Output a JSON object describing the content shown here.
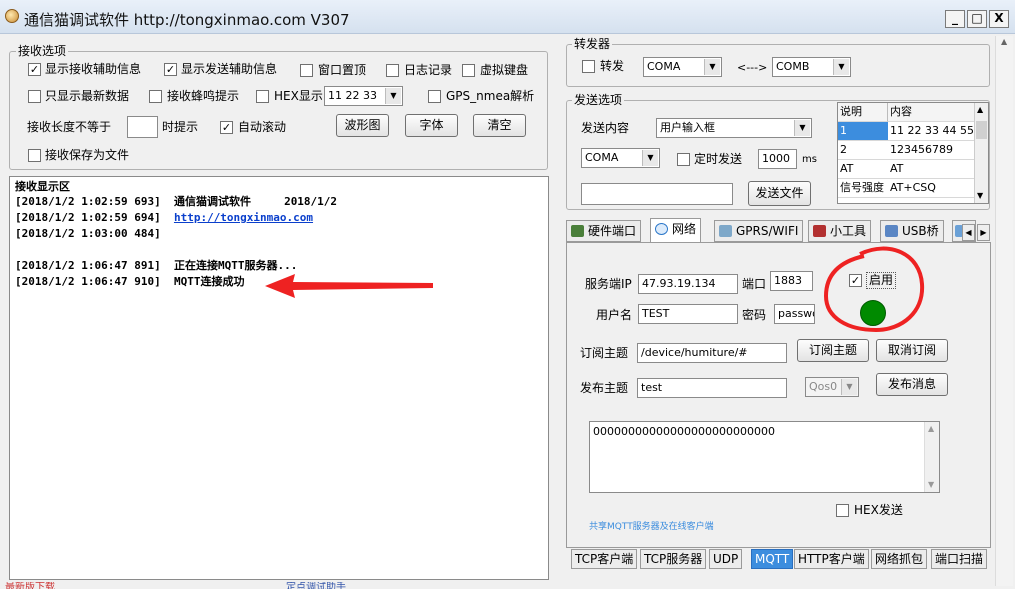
{
  "window": {
    "title": "通信猫调试软件  http://tongxinmao.com  V307",
    "minimize": "_",
    "maximize": "□",
    "close": "X"
  },
  "recv_options": {
    "group_label": "接收选项",
    "show_recv_info": "显示接收辅助信息",
    "show_send_info": "显示发送辅助信息",
    "window_top": "窗口置顶",
    "log_record": "日志记录",
    "virtual_keyboard": "虚拟键盘",
    "latest_only": "只显示最新数据",
    "beep": "接收蜂鸣提示",
    "hex_display": "HEX显示",
    "hex_value": "11 22 33",
    "gps": "GPS_nmea解析",
    "len_not_equal": "接收长度不等于",
    "len_value": "",
    "when_alert": "时提示",
    "auto_scroll": "自动滚动",
    "waveform_btn": "波形图",
    "font_btn": "字体",
    "clear_btn": "清空",
    "save_file": "接收保存为文件"
  },
  "recv_area": {
    "title": "接收显示区",
    "lines": [
      {
        "ts": "[2018/1/2 1:02:59 693]",
        "msg": "通信猫调试软件     2018/1/2"
      },
      {
        "ts": "[2018/1/2 1:02:59 694]",
        "link": "http://tongxinmao.com"
      },
      {
        "ts": "[2018/1/2 1:03:00 484]",
        "msg": ""
      },
      {
        "ts": "[2018/1/2 1:06:47 891]",
        "msg": "正在连接MQTT服务器..."
      },
      {
        "ts": "[2018/1/2 1:06:47 910]",
        "msg": "MQTT连接成功"
      }
    ]
  },
  "forwarder": {
    "group_label": "转发器",
    "forward_label": "转发",
    "port_a": "COMA",
    "arrow": "<--->",
    "port_b": "COMB"
  },
  "send_options": {
    "group_label": "发送选项",
    "content_label": "发送内容",
    "content_mode": "用户输入框",
    "port": "COMA",
    "timed_send": "定时发送",
    "interval": "1000",
    "unit": "ms",
    "input_value": "",
    "send_file_btn": "发送文件"
  },
  "cmd_table": {
    "headers": [
      "说明",
      "内容"
    ],
    "rows": [
      [
        "1",
        "11 22 33 44 55"
      ],
      [
        "2",
        "123456789"
      ],
      [
        "AT",
        "AT"
      ],
      [
        "信号强度",
        "AT+CSQ"
      ]
    ]
  },
  "top_tabs": [
    "硬件端口",
    "网络",
    "GPRS/WIFI",
    "小工具",
    "USB桥",
    "("
  ],
  "mqtt": {
    "server_ip_label": "服务端IP",
    "server_ip": "47.93.19.134",
    "port_label": "端口",
    "port": "1883",
    "enable_label": "启用",
    "username_label": "用户名",
    "username": "TEST",
    "password_label": "密码",
    "password": "passwo",
    "sub_topic_label": "订阅主题",
    "sub_topic": "/device/humiture/#",
    "subscribe_btn": "订阅主题",
    "unsubscribe_btn": "取消订阅",
    "pub_topic_label": "发布主题",
    "pub_topic": "test",
    "qos": "Qos0",
    "publish_btn": "发布消息",
    "message": "00000000000000000000000000",
    "hex_send": "HEX发送",
    "footer_note": "共享MQTT服务器及在线客户端"
  },
  "bottom_tabs": [
    "TCP客户端",
    "TCP服务器",
    "UDP",
    "MQTT",
    "HTTP客户端",
    "网络抓包",
    "端口扫描"
  ],
  "status_bar": {
    "left": "最新版下载",
    "mid": "定点调试助手"
  },
  "colors": {
    "status_led": "#008a00",
    "annotation": "#ee2222",
    "active_tab": "#3c8dde",
    "link": "#0a3fcc"
  }
}
